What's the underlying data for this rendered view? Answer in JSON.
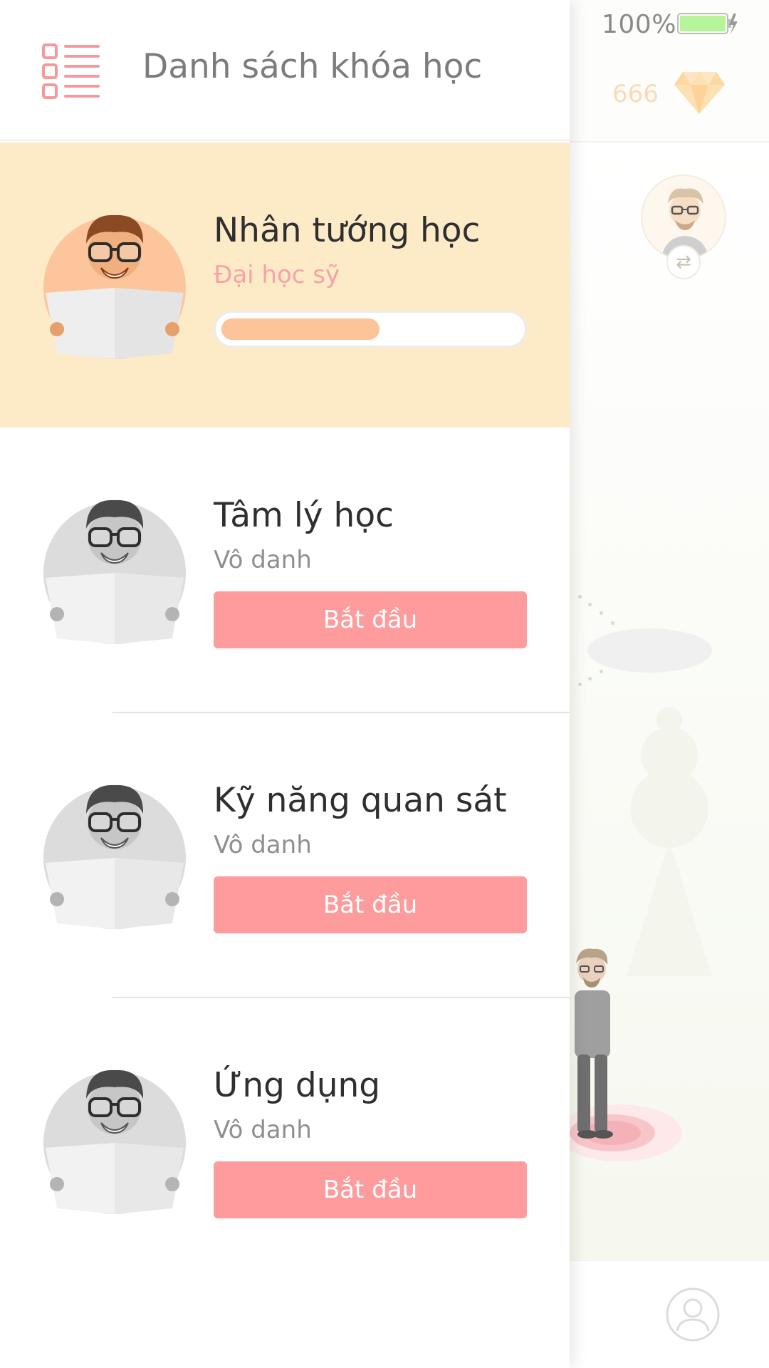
{
  "status_bar": {
    "battery_percent": "100%",
    "battery_level": 1.0,
    "battery_color": "#b6f59a"
  },
  "background_app": {
    "gem_count": "666",
    "gem_icon": "diamond-icon",
    "swap_icon": "⇄",
    "profile_icon": "user-profile-icon"
  },
  "drawer": {
    "menu_icon": "list-menu-icon",
    "title": "Danh sách khóa học",
    "courses": [
      {
        "name": "Nhân tướng học",
        "level": "Đại học sỹ",
        "active": true,
        "progress": 0.53
      },
      {
        "name": "Tâm lý học",
        "level": "Vô danh",
        "button_label": "Bắt đầu"
      },
      {
        "name": "Kỹ năng quan sát",
        "level": "Vô danh",
        "button_label": "Bắt đầu"
      },
      {
        "name": "Ứng dụng",
        "level": "Vô danh",
        "button_label": "Bắt đầu"
      }
    ]
  },
  "colors": {
    "accent_button": "#fe9b9c",
    "active_row": "#fdebc8",
    "progress_fill": "#fdc49a",
    "level_active": "#f6a3a8"
  }
}
